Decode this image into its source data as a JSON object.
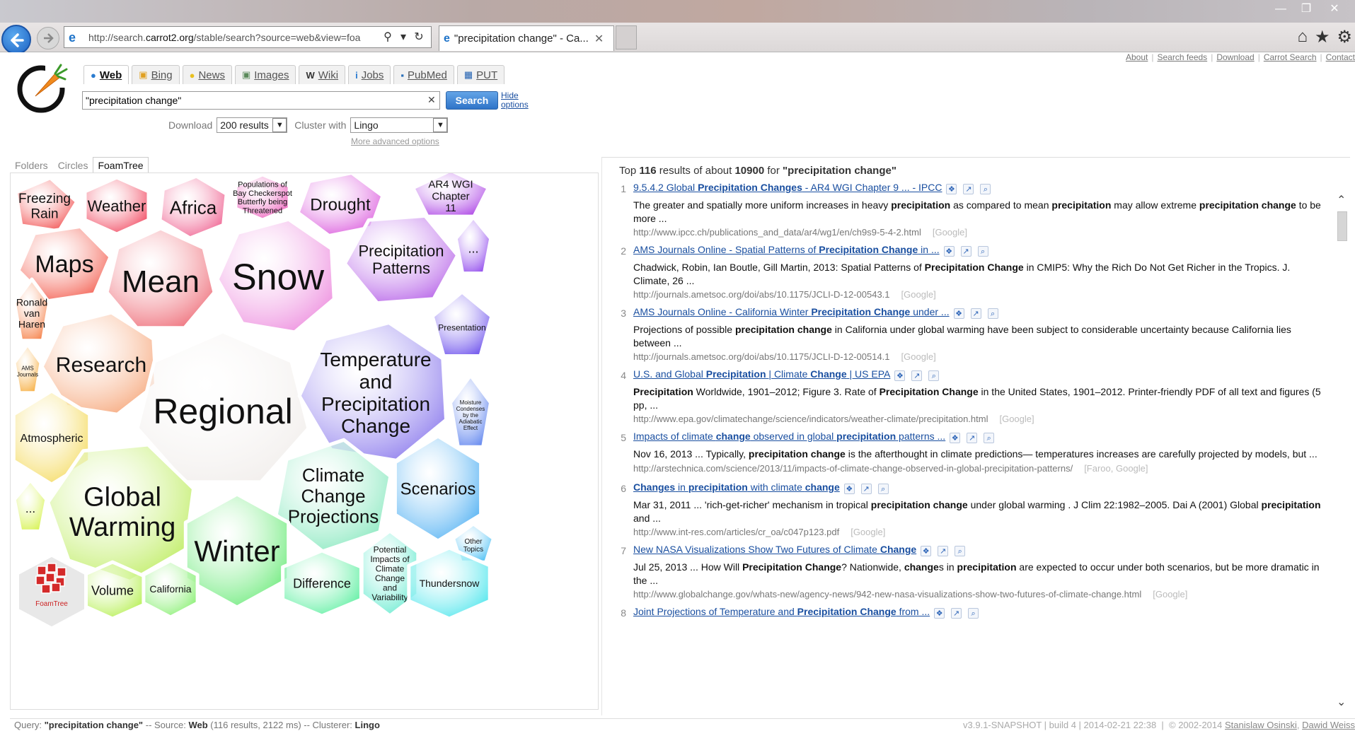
{
  "browser": {
    "url": "http://search.carrot2.org/stable/search?source=web&view=foa",
    "url_host_highlight": "carrot2.org",
    "tab_title": "\"precipitation change\" - Ca...",
    "icons": [
      "back-icon",
      "forward-icon",
      "search-icon",
      "refresh-icon",
      "home-icon",
      "star-icon",
      "gear-icon"
    ]
  },
  "top_links": [
    "About",
    "Search feeds",
    "Download",
    "Carrot Search",
    "Contact"
  ],
  "sources": [
    {
      "label": "Web",
      "icon": "globe-icon",
      "active": true
    },
    {
      "label": "Bing",
      "icon": "bing-icon",
      "active": false
    },
    {
      "label": "News",
      "icon": "bulb-icon",
      "active": false
    },
    {
      "label": "Images",
      "icon": "image-icon",
      "active": false
    },
    {
      "label": "Wiki",
      "icon": "wiki-icon",
      "active": false
    },
    {
      "label": "Jobs",
      "icon": "info-icon",
      "active": false
    },
    {
      "label": "PubMed",
      "icon": "pubmed-icon",
      "active": false
    },
    {
      "label": "PUT",
      "icon": "put-icon",
      "active": false
    }
  ],
  "search": {
    "query": "\"precipitation change\"",
    "button": "Search",
    "hide_options_line1": "Hide",
    "hide_options_line2": "options"
  },
  "options": {
    "download_label": "Download",
    "download_value": "200 results",
    "cluster_label": "Cluster with",
    "cluster_value": "Lingo",
    "more_advanced": "More advanced options"
  },
  "view_tabs": [
    {
      "label": "Folders",
      "active": false
    },
    {
      "label": "Circles",
      "active": false
    },
    {
      "label": "FoamTree",
      "active": true
    }
  ],
  "foamtree": {
    "logo_label": "FoamTree",
    "clusters": [
      {
        "lines": [
          "Freezing",
          "Rain"
        ],
        "color": "#f25a5a"
      },
      {
        "lines": [
          "Weather"
        ],
        "color": "#f2576d"
      },
      {
        "lines": [
          "Africa"
        ],
        "color": "#f06b97"
      },
      {
        "lines": [
          "Populations of",
          "Bay Checkerspot",
          "Butterfly being",
          "Threatened"
        ],
        "color": "#ee6bc1"
      },
      {
        "lines": [
          "Drought"
        ],
        "color": "#dd64df"
      },
      {
        "lines": [
          "AR4 WGI",
          "Chapter",
          "11"
        ],
        "color": "#b65ae8"
      },
      {
        "lines": [
          "Maps"
        ],
        "color": "#f46a5d"
      },
      {
        "lines": [
          "Mean"
        ],
        "color": "#f07e88"
      },
      {
        "lines": [
          "Snow"
        ],
        "color": "#ef9ae2"
      },
      {
        "lines": [
          "Precipitation",
          "Patterns"
        ],
        "color": "#bd71ea"
      },
      {
        "lines": [
          "..."
        ],
        "color": "#9957ee"
      },
      {
        "lines": [
          "Ronald",
          "van",
          "Haren"
        ],
        "color": "#f68a56"
      },
      {
        "lines": [
          "Research"
        ],
        "color": "#f7b18a"
      },
      {
        "lines": [
          "Presentation"
        ],
        "color": "#7b62ee"
      },
      {
        "lines": [
          "AMS",
          "Journals"
        ],
        "color": "#f7b24a"
      },
      {
        "lines": [
          "Regional"
        ],
        "color": "#f3f0ee"
      },
      {
        "lines": [
          "Temperature",
          "and",
          "Precipitation",
          "Change"
        ],
        "color": "#9a8bef"
      },
      {
        "lines": [
          "Moisture",
          "Condenses",
          "by the",
          "Adiabatic",
          "Effect"
        ],
        "color": "#6d8ff0"
      },
      {
        "lines": [
          "Atmospheric"
        ],
        "color": "#f5dd6a"
      },
      {
        "lines": [
          "Global",
          "Warming"
        ],
        "color": "#c3ee6d"
      },
      {
        "lines": [
          "..."
        ],
        "color": "#d8f358"
      },
      {
        "lines": [
          "Climate",
          "Change",
          "Projections"
        ],
        "color": "#92eac4"
      },
      {
        "lines": [
          "Scenarios"
        ],
        "color": "#64b9f4"
      },
      {
        "lines": [
          "Winter"
        ],
        "color": "#79ec86"
      },
      {
        "lines": [
          "Other",
          "Topics"
        ],
        "color": "#58c4f5"
      },
      {
        "lines": [
          "Volume"
        ],
        "color": "#b9f05a"
      },
      {
        "lines": [
          "California"
        ],
        "color": "#8ff07a"
      },
      {
        "lines": [
          "Difference"
        ],
        "color": "#6af0a8"
      },
      {
        "lines": [
          "Potential",
          "Impacts of",
          "Climate",
          "Change",
          "and",
          "Variability"
        ],
        "color": "#72ecd3"
      },
      {
        "lines": [
          "Thundersnow"
        ],
        "color": "#5fe8ee"
      }
    ]
  },
  "results_header": {
    "prefix": "Top",
    "count": "116",
    "middle": "results of about",
    "total": "10900",
    "for": "for",
    "query": "\"precipitation change\""
  },
  "results": [
    {
      "num": "1",
      "title_html": "9.5.4.2 Global <b>Precipitation Changes</b> - AR4 WGI Chapter 9 ... - IPCC",
      "snippet_html": "The greater and spatially more uniform increases in heavy <b>precipitation</b> as compared to mean <b>precipitation</b> may allow extreme <b>precipitation change</b> to be more ...",
      "url": "http://www.ipcc.ch/publications_and_data/ar4/wg1/en/ch9s9-5-4-2.html",
      "sources": "[Google]"
    },
    {
      "num": "2",
      "title_html": "AMS Journals Online - Spatial Patterns of <b>Precipitation Change</b> in ...",
      "snippet_html": "Chadwick, Robin, Ian Boutle, Gill Martin, 2013: Spatial Patterns of <b>Precipitation Change</b> in CMIP5: Why the Rich Do Not Get Richer in the Tropics. J. Climate, 26 ...",
      "url": "http://journals.ametsoc.org/doi/abs/10.1175/JCLI-D-12-00543.1",
      "sources": "[Google]"
    },
    {
      "num": "3",
      "title_html": "AMS Journals Online - California Winter <b>Precipitation Change</b> under ...",
      "snippet_html": "Projections of possible <b>precipitation change</b> in California under global warming have been subject to considerable uncertainty because California lies between ...",
      "url": "http://journals.ametsoc.org/doi/abs/10.1175/JCLI-D-12-00514.1",
      "sources": "[Google]"
    },
    {
      "num": "4",
      "title_html": "U.S. and Global <b>Precipitation</b> | Climate <b>Change</b> | US EPA",
      "snippet_html": "<b>Precipitation</b> Worldwide, 1901–2012; Figure 3. Rate of <b>Precipitation Change</b> in the United States, 1901–2012. Printer-friendly PDF of all text and figures (5 pp, ...",
      "url": "http://www.epa.gov/climatechange/science/indicators/weather-climate/precipitation.html",
      "sources": "[Google]"
    },
    {
      "num": "5",
      "title_html": "Impacts of climate <b>change</b> observed in global <b>precipitation</b> patterns ...",
      "snippet_html": "Nov 16, 2013 ... Typically, <b>precipitation change</b> is the afterthought in climate predictions— temperatures increases are carefully projected by models, but ...",
      "url": "http://arstechnica.com/science/2013/11/impacts-of-climate-change-observed-in-global-precipitation-patterns/",
      "sources": "[Faroo, Google]"
    },
    {
      "num": "6",
      "title_html": "<b>Changes</b> in <b>precipitation</b> with climate <b>change</b>",
      "snippet_html": "Mar 31, 2011 ... 'rich-get-richer' mechanism in tropical <b>precipitation change</b> under global warming . J Clim 22:1982–2005. Dai A (2001) Global <b>precipitation</b> and ...",
      "url": "http://www.int-res.com/articles/cr_oa/c047p123.pdf",
      "sources": "[Google]"
    },
    {
      "num": "7",
      "title_html": "New NASA Visualizations Show Two Futures of Climate <b>Change</b>",
      "snippet_html": "Jul 25, 2013 ... How Will <b>Precipitation Change</b>? Nationwide, <b>change</b>s in <b>precipitation</b> are expected to occur under both scenarios, but be more dramatic in the ...",
      "url": "http://www.globalchange.gov/whats-new/agency-news/942-new-nasa-visualizations-show-two-futures-of-climate-change.html",
      "sources": "[Google]"
    },
    {
      "num": "8",
      "title_html": "Joint Projections of Temperature and <b>Precipitation Change</b> from ...",
      "snippet_html": "",
      "url": "",
      "sources": ""
    }
  ],
  "status": {
    "query_label": "Query:",
    "query": "\"precipitation change\"",
    "source_label": "-- Source:",
    "source": "Web",
    "source_detail": "(116 results, 2122 ms) -- Clusterer:",
    "clusterer": "Lingo",
    "version": "v3.9.1-SNAPSHOT | build 4 | 2014-02-21 22:38",
    "copyright": "© 2002-2014",
    "author1": "Stanislaw Osinski",
    "author2": "Dawid Weiss"
  }
}
